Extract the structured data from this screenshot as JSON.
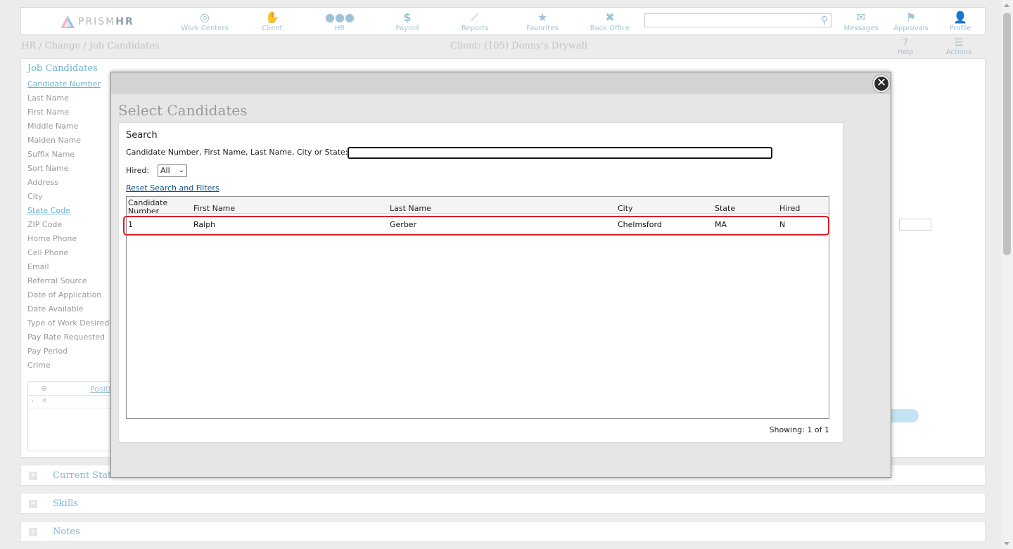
{
  "nav": {
    "logo_light": "PRISM",
    "logo_bold": "HR",
    "items": [
      {
        "label": "Work Centers",
        "icon": "target-icon"
      },
      {
        "label": "Client",
        "icon": "handshake-icon"
      },
      {
        "label": "HR",
        "icon": "people-icon"
      },
      {
        "label": "Payroll",
        "icon": "dollar-icon"
      },
      {
        "label": "Reports",
        "icon": "chart-icon"
      },
      {
        "label": "Favorites",
        "icon": "star-icon"
      },
      {
        "label": "Back Office",
        "icon": "tools-icon"
      }
    ],
    "right_items": [
      {
        "label": "Messages",
        "icon": "envelope-icon"
      },
      {
        "label": "Approvals",
        "icon": "flag-icon"
      },
      {
        "label": "Profile",
        "icon": "user-icon"
      }
    ]
  },
  "header": {
    "breadcrumb": "HR / Change / Job Candidates",
    "client": "Client: (105) Donny's Drywall",
    "help": "Help",
    "actions": "Actions"
  },
  "form": {
    "title": "Job Candidates",
    "fields": [
      "Candidate Number",
      "Last Name",
      "First Name",
      "Middle Name",
      "Maiden Name",
      "Suffix Name",
      "Sort Name",
      "Address",
      "City",
      "State Code",
      "ZIP Code",
      "Home Phone",
      "Cell Phone",
      "Email",
      "Referral Source",
      "Date of Application",
      "Date Available",
      "Type of Work Desired",
      "Pay Rate Requested",
      "Pay Period",
      "Crime"
    ],
    "subgrid_header": "Positi"
  },
  "sections": [
    "Current Status",
    "Skills",
    "Notes"
  ],
  "modal": {
    "title": "Select Candidates",
    "search_heading": "Search",
    "criteria_label": "Candidate Number, First Name, Last Name, City or State:",
    "criteria_value": "",
    "hired_label": "Hired:",
    "hired_value": "All",
    "reset_link": "Reset Search and Filters",
    "columns": [
      "Candidate Number",
      "First Name",
      "Last Name",
      "City",
      "State",
      "Hired"
    ],
    "rows": [
      {
        "number": "1",
        "first": "Ralph",
        "last": "Gerber",
        "city": "Chelmsford",
        "state": "MA",
        "hired": "N"
      }
    ],
    "showing": "Showing: 1 of 1"
  }
}
